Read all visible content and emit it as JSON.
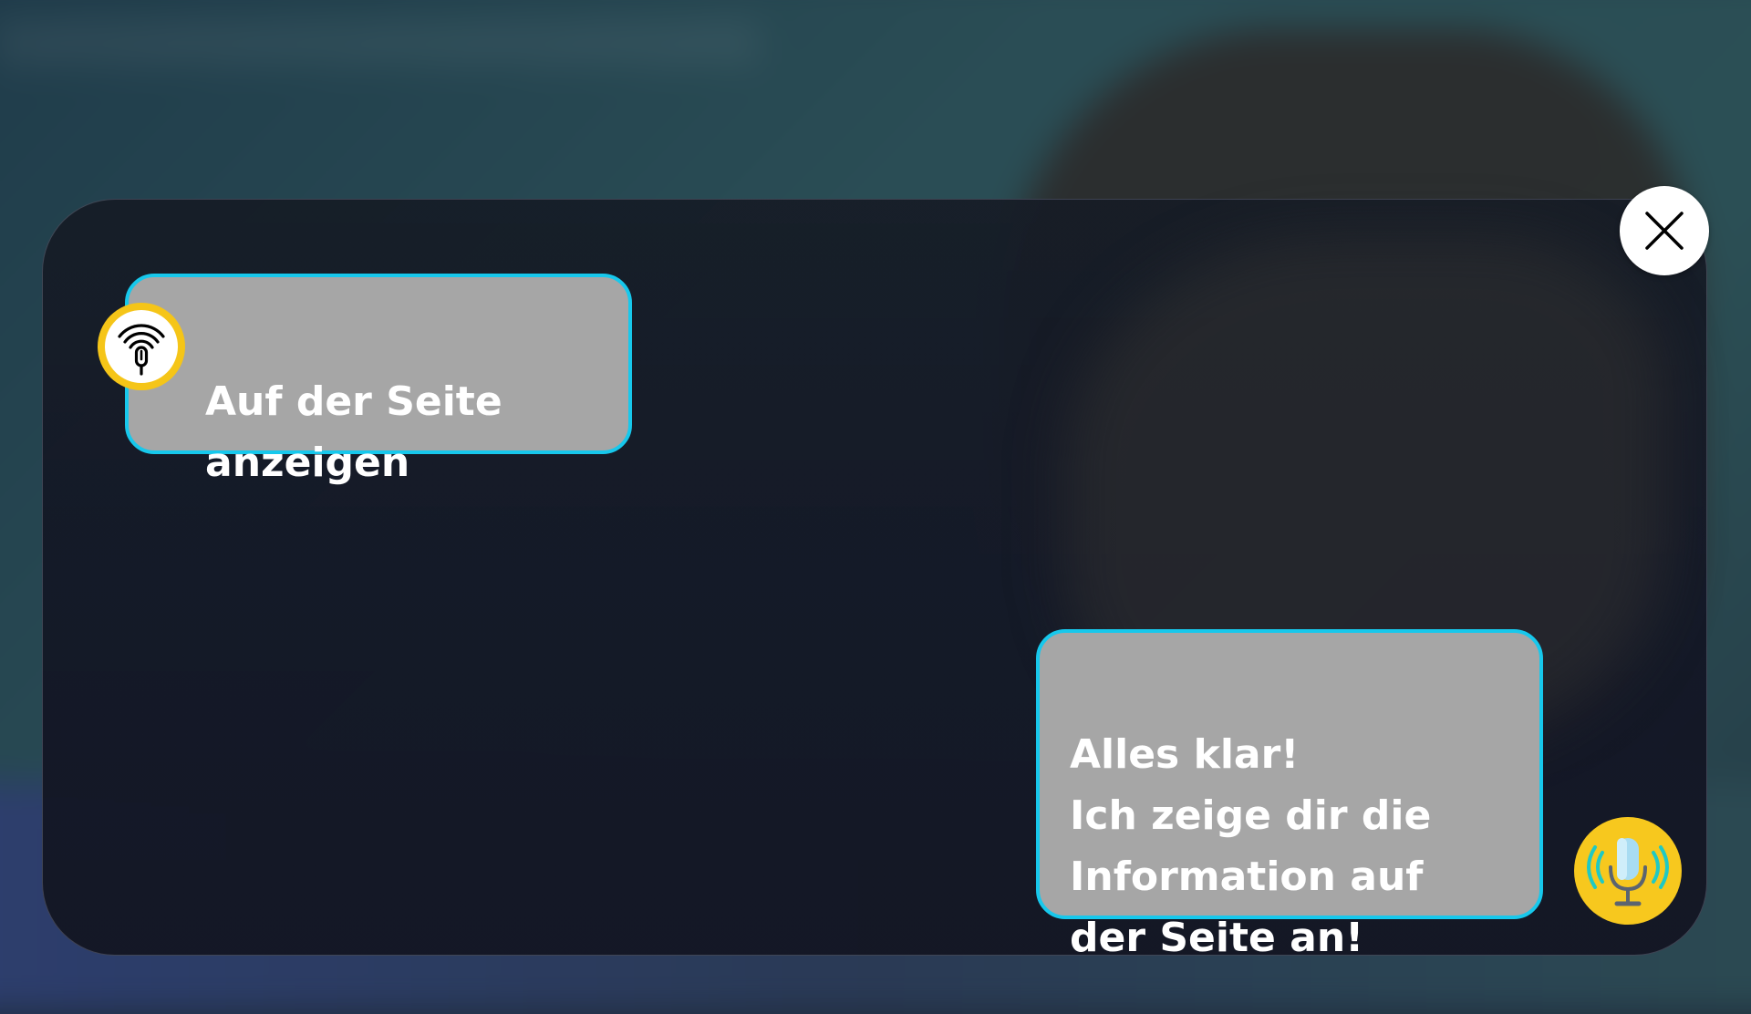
{
  "dialog": {
    "user_message": "Auf der Seite\nanzeigen",
    "assistant_message": "Alles klar!\nIch zeige dir die\nInformation auf\nder Seite an!"
  },
  "icons": {
    "close": "close-icon",
    "user_avatar": "voice-signal-mic-icon",
    "mic_button": "microphone-icon"
  },
  "colors": {
    "bubble_bg": "#a6a6a6",
    "bubble_border": "#17c8ec",
    "avatar_yellow": "#f5c518",
    "panel_bg": "#161c26"
  }
}
